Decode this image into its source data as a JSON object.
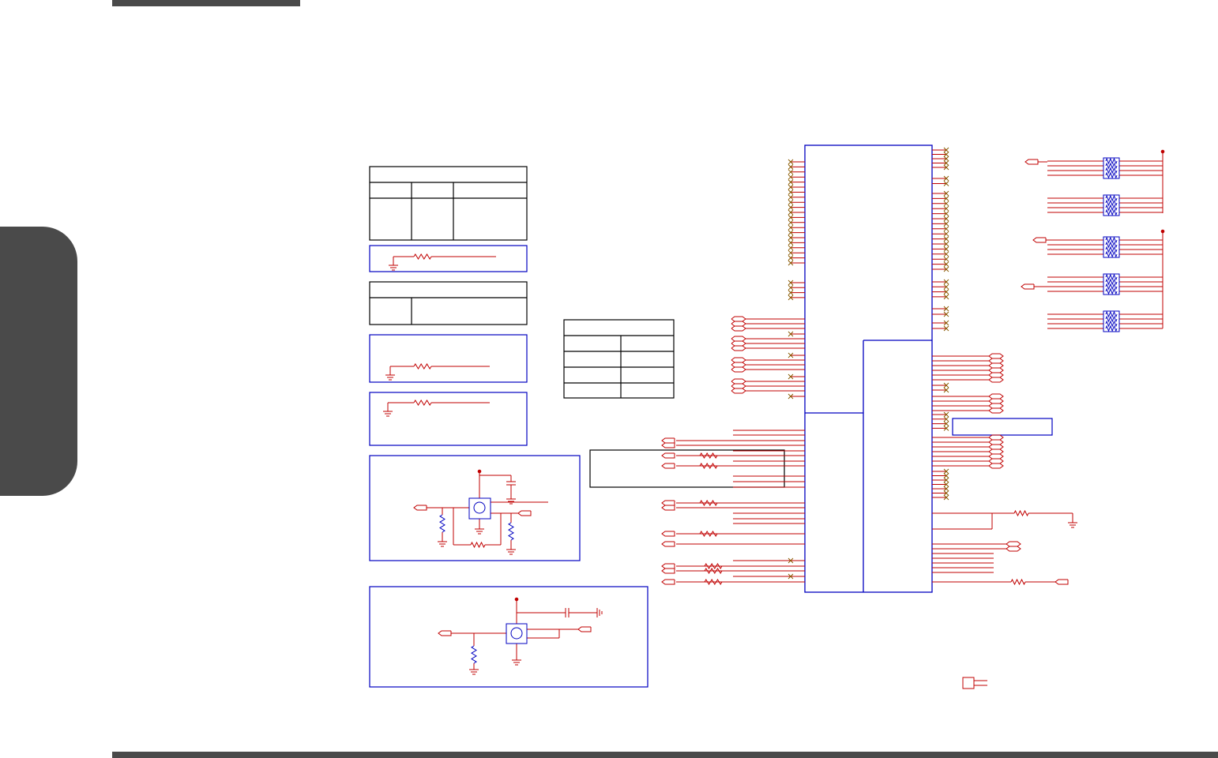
{
  "page": {
    "header_bar": "",
    "side_tab": "",
    "footer_bar": ""
  },
  "schematic": {
    "wire_color": "#c00000",
    "frame_color": "#0000c0",
    "border_color": "#000000",
    "no_connect_color": "#8a5a00",
    "labels": []
  }
}
